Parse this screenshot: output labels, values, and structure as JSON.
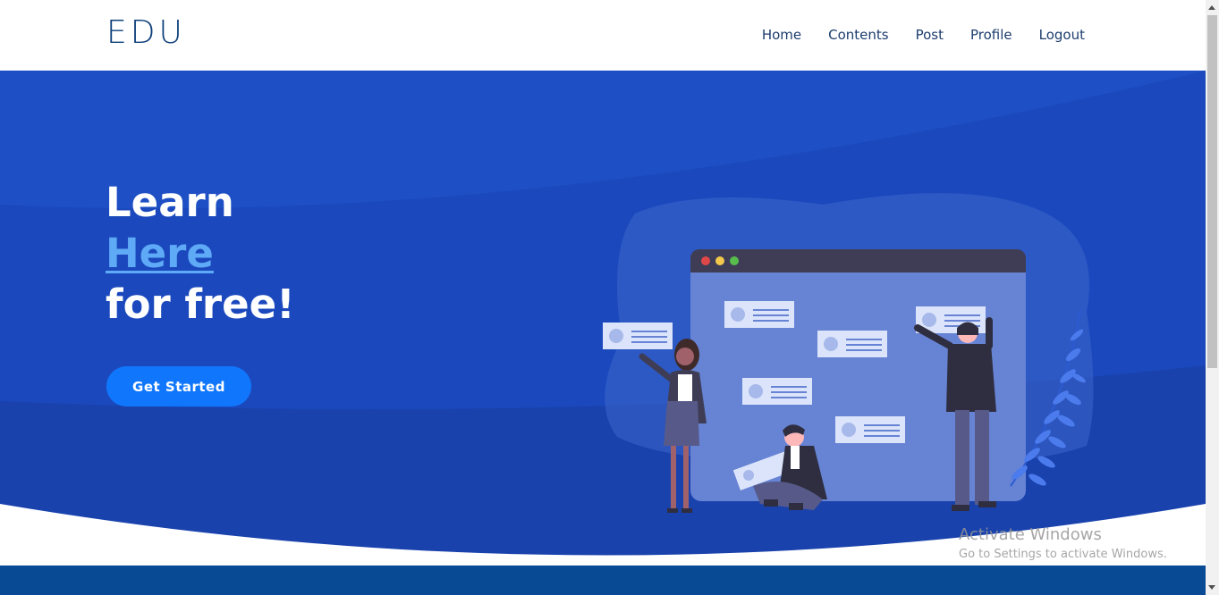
{
  "brand": {
    "logo": "EDU"
  },
  "nav": {
    "items": [
      {
        "label": "Home"
      },
      {
        "label": "Contents"
      },
      {
        "label": "Post"
      },
      {
        "label": "Profile"
      },
      {
        "label": "Logout"
      }
    ]
  },
  "hero": {
    "line1": "Learn",
    "line2": "Here",
    "line3": "for free!",
    "cta_label": "Get Started"
  },
  "watermark": {
    "title": "Activate Windows",
    "subtitle": "Go to Settings to activate Windows."
  },
  "colors": {
    "hero_bg": "#1e4fc4",
    "accent_link": "#5eaaf6",
    "button": "#1077fd",
    "footer_band": "#084a93"
  }
}
